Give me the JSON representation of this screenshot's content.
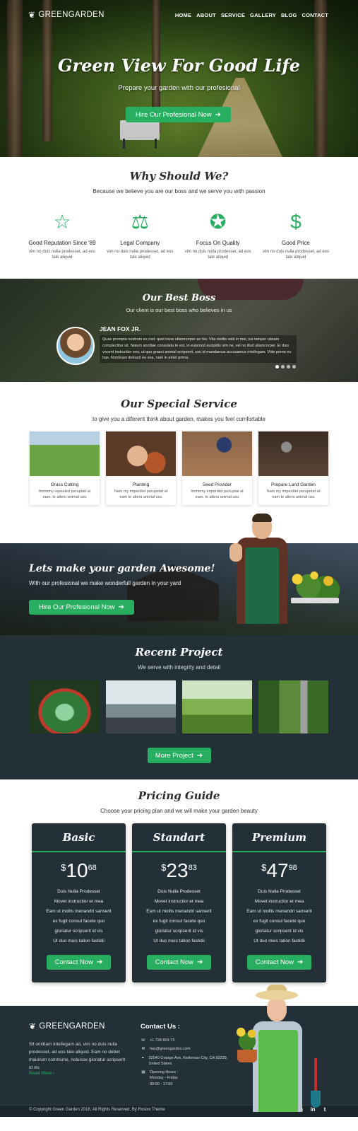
{
  "brand": {
    "name": "GREENGARDEN"
  },
  "nav": [
    "HOME",
    "ABOUT",
    "SERVICE",
    "GALLERY",
    "BLOG",
    "CONTACT"
  ],
  "hero": {
    "title": "Green View For Good Life",
    "subtitle": "Prepare your garden with our profesional",
    "button": "Hire Our Profesional Now"
  },
  "why": {
    "title": "Why Should We?",
    "subtitle": "Because we believe you are our boss and we serve you with passion",
    "features": [
      {
        "icon": "star-icon",
        "title": "Good Reputation Since '89",
        "desc": "vim no duis nulla prodesset, ad eos tale aliquid"
      },
      {
        "icon": "scales-icon",
        "title": "Legal Company",
        "desc": "vim no duis nulla prodesset, ad eos tale aliquid"
      },
      {
        "icon": "award-ribbon-icon",
        "title": "Focus On Quality",
        "desc": "vim no duis nulla prodesset, ad eos tale aliquid"
      },
      {
        "icon": "hand-dollar-icon",
        "title": "Good Price",
        "desc": "vim no duis nulla prodesset, ad eos tale aliquid"
      }
    ]
  },
  "boss": {
    "title": "Our Best Boss",
    "subtitle": "Our client is our best boss who believes in us",
    "name": "JEAN FOX JR.",
    "quote": "Quas prompta nostrum ex mel, quot iriure ullamcorper an his. Vita mollis velit in mei, ius tamper utinam complectitur sit. Natum ancillae consulatu te est, in euismod euripidis vim ne, vel no illud ullamcorper. Ei duis vocent instructior eos, ut quo graeci animal scripserit, usu id mandamus accusamus intellegam. Vide prima eu has. Nominavi detraxit eu sea, nam in amet prima.",
    "slides": 4,
    "active_slide": 1
  },
  "services": {
    "title": "Our Special Service",
    "subtitle": "to give you a diferent think about garden, makes you feel comfortable",
    "items": [
      {
        "title": "Grass Cutting",
        "desc": "homemy repeated peruptati at eam, te alteru animal usu"
      },
      {
        "title": "Planting",
        "desc": "Nam my imperdiet perupetat at eam te altera animal usu"
      },
      {
        "title": "Seed Provider",
        "desc": "homemy imperdiet periuptat at eam, te altera animal usu"
      },
      {
        "title": "Prepare Land Garden",
        "desc": "Nam my imperdiet perupetat at eam te altera animal usu"
      }
    ]
  },
  "cta": {
    "title": "Lets make your garden Awesome!",
    "subtitle": "With our profesional we make wonderfull garden in your yard",
    "button": "Hire Our Profesional Now"
  },
  "projects": {
    "title": "Recent Project",
    "subtitle": "We serve with integrity and detail",
    "button": "More Project"
  },
  "pricing": {
    "title": "Pricing Guide",
    "subtitle": "Choose your pricing plan and we will make your garden beauty",
    "currency": "$",
    "plans": [
      {
        "name": "Basic",
        "whole": "10",
        "cents": "68"
      },
      {
        "name": "Standart",
        "whole": "23",
        "cents": "83"
      },
      {
        "name": "Premium",
        "whole": "47",
        "cents": "98"
      }
    ],
    "features": [
      "Duis Nulla Prodesset",
      "Movet instructior et mea",
      "Eam ut mollis menandri sanserit",
      "ex fugit consul facete quo",
      "gloriatur scripserit id vis",
      "Ut duo meis tation fastidii"
    ],
    "button": "Contact Now"
  },
  "footer": {
    "about": "Sit omittam intellegam ad, vim no duis nulla prodesset, ad eos tale aliquid. Eam no debet maiorum commune, noluisse gloriatur scripserit id vis",
    "read_more": "Read More ›",
    "contact_title": "Contact Us :",
    "phone": "+1 728 829 73",
    "email": "hay@greengarden.com",
    "address": "32040 Orange Ave, Ketteman City, CA 93239, United States",
    "hours_label": "Opening Hours :",
    "hours_days": "Monday - Friday",
    "hours_time": "09:00 - 17:00",
    "copyright": "© Copyright Green Garden 2018, All Rights Reserved, By Rosixx Theme",
    "social": [
      "facebook-icon",
      "google-plus-icon",
      "instagram-icon",
      "linkedin-icon",
      "twitter-icon"
    ]
  },
  "colors": {
    "accent": "#27ae60",
    "dark": "#233038"
  }
}
